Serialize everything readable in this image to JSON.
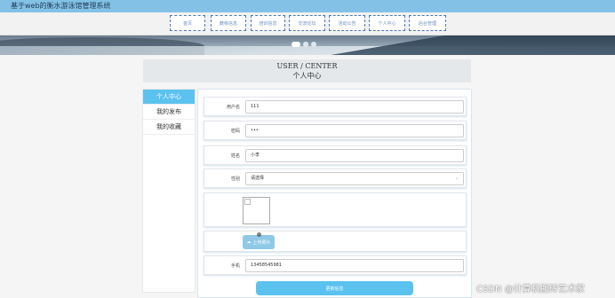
{
  "site": {
    "title": "基于web的衡水游泳馆管理系统"
  },
  "nav": {
    "items": [
      {
        "label": "首页"
      },
      {
        "label": "教练信息"
      },
      {
        "label": "培训信息"
      },
      {
        "label": "交流论坛"
      },
      {
        "label": "活动公告"
      },
      {
        "label": "个人中心"
      },
      {
        "label": "后台管理"
      }
    ]
  },
  "carousel": {
    "slide_count": 3,
    "active_index": 0
  },
  "page_header": {
    "title_en": "USER / CENTER",
    "title_cn": "个人中心"
  },
  "sidebar": {
    "items": [
      {
        "label": "个人中心",
        "active": true
      },
      {
        "label": "我的发布",
        "active": false
      },
      {
        "label": "我的收藏",
        "active": false
      }
    ]
  },
  "form": {
    "username": {
      "label": "用户名",
      "value": "111"
    },
    "password": {
      "label": "密码",
      "value": "•••"
    },
    "name": {
      "label": "姓名",
      "value": "小李"
    },
    "gender": {
      "label": "性别",
      "value": "请选择"
    },
    "upload": {
      "label": "上传照片"
    },
    "phone": {
      "label": "手机",
      "value": "13458545981"
    },
    "submit": {
      "label": "更新信息"
    }
  },
  "watermark": {
    "text": "CSDN @计算机搬砖艺术家"
  },
  "colors": {
    "accent": "#5bc2ef",
    "topbar": "#83c1e6",
    "nav_border": "#4d7bb5"
  }
}
